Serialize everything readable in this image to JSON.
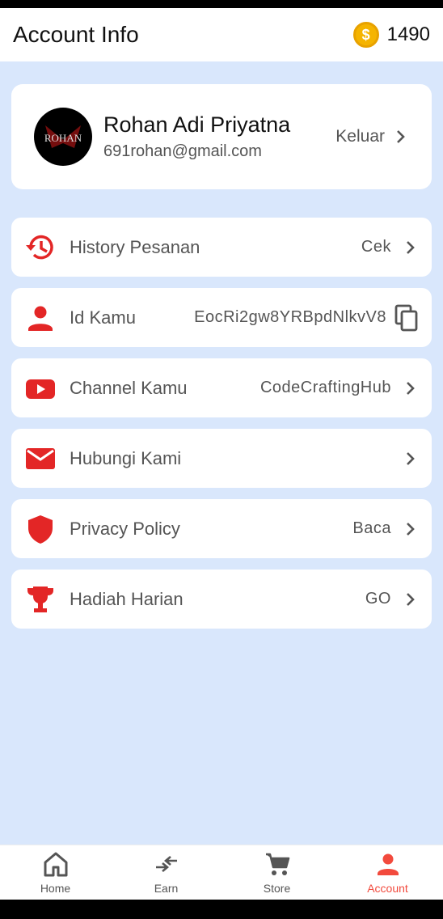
{
  "header": {
    "title": "Account Info",
    "coin_count": "1490"
  },
  "profile": {
    "name": "Rohan Adi Priyatna",
    "email": "691rohan@gmail.com",
    "logout_label": "Keluar",
    "avatar_text": "ROHAN"
  },
  "menu": {
    "history": {
      "label": "History Pesanan",
      "value": "Cek"
    },
    "id": {
      "label": "Id Kamu",
      "value": "EocRi2gw8YRBpdNlkvV8"
    },
    "channel": {
      "label": "Channel Kamu",
      "value": "CodeCraftingHub"
    },
    "contact": {
      "label": "Hubungi Kami"
    },
    "privacy": {
      "label": "Privacy Policy",
      "value": "Baca"
    },
    "reward": {
      "label": "Hadiah Harian",
      "value": "GO"
    }
  },
  "nav": {
    "home": "Home",
    "earn": "Earn",
    "store": "Store",
    "account": "Account"
  },
  "colors": {
    "accent": "#f24a3d",
    "background": "#d9e7fc",
    "coin": "#f5b400"
  }
}
